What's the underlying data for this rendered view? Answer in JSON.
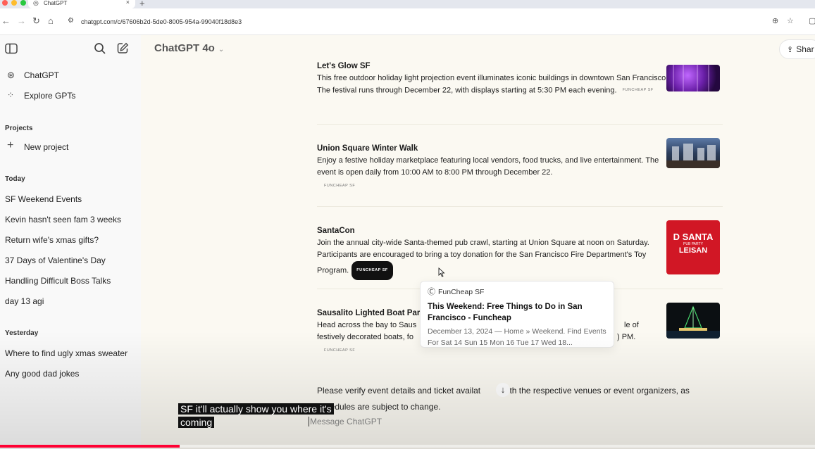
{
  "browser": {
    "tab_title": "ChatGPT",
    "tab_close": "×",
    "new_tab": "+",
    "url": "chatgpt.com/c/67606b2d-5de0-8005-954a-99040f18d8e3"
  },
  "sidebar": {
    "items": [
      {
        "label": "ChatGPT",
        "icon": "chatgpt-logo-icon"
      },
      {
        "label": "Explore GPTs",
        "icon": "grid-icon"
      }
    ],
    "projects_heading": "Projects",
    "new_project": "New project",
    "today_heading": "Today",
    "today": [
      "SF Weekend Events",
      "Kevin hasn't seen fam 3 weeks",
      "Return wife's xmas gifts?",
      "37 Days of Valentine's Day",
      "Handling Difficult Boss Talks",
      "day 13 agi"
    ],
    "yesterday_heading": "Yesterday",
    "yesterday": [
      "Where to find ugly xmas sweater",
      "Any good dad jokes"
    ]
  },
  "header": {
    "model": "ChatGPT 4o",
    "share": "Shar"
  },
  "events": [
    {
      "title": "Let's Glow SF",
      "desc": "This free outdoor holiday light projection event illuminates iconic buildings in downtown San Francisco. The festival runs through December 22, with displays starting at 5:30 PM each evening.",
      "source": "FUNCHEAP SF"
    },
    {
      "title": "Union Square Winter Walk",
      "desc": "Enjoy a festive holiday marketplace featuring local vendors, food trucks, and live entertainment. The event is open daily from 10:00 AM to 8:00 PM through December 22.",
      "source": "FUNCHEAP SF"
    },
    {
      "title": "SantaCon",
      "desc": "Join the annual city-wide Santa-themed pub crawl, starting at Union Square at noon on Saturday. Participants are encouraged to bring a toy donation for the San Francisco Fire Department's Toy Program.",
      "source": "FUNCHEAP SF"
    },
    {
      "title": "Sausalito Lighted Boat Para",
      "desc_a": "Head across the bay to Saus",
      "desc_a_end": "le of",
      "desc_b": "festively decorated boats, fo",
      "desc_b_end": ") PM.",
      "source": "FUNCHEAP SF"
    }
  ],
  "thumb_santa": {
    "line1": "D SANTA",
    "line2": "PUB PARTY",
    "line3": "LEISAN"
  },
  "popover": {
    "source": "FunCheap SF",
    "title": "This Weekend: Free Things to Do in San Francisco - Funcheap",
    "snippet": "December 13, 2024 — Home » Weekend. Find Events For Sat 14 Sun 15 Mon 16 Tue 17 Wed 18..."
  },
  "verify": {
    "a": "Please verify event details and ticket availat",
    "b": "with the respective venues or event organizers, as",
    "c": "schedules are subject to change."
  },
  "composer": {
    "placeholder": "Message ChatGPT"
  },
  "caption": "SF it'll actually show you where it's coming",
  "video": {
    "progress": 0.22
  }
}
